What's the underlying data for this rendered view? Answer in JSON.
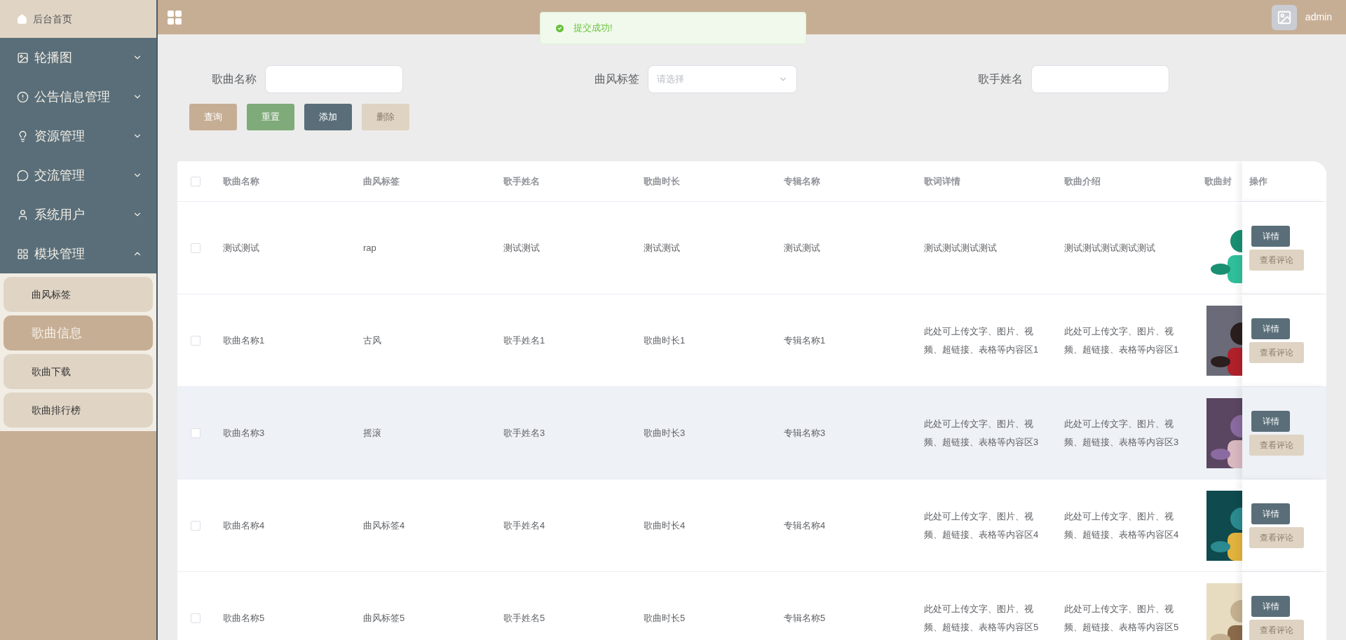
{
  "sidebar": {
    "home": "后台首页",
    "items": [
      {
        "label": "轮播图",
        "expanded": false
      },
      {
        "label": "公告信息管理",
        "expanded": false
      },
      {
        "label": "资源管理",
        "expanded": false
      },
      {
        "label": "交流管理",
        "expanded": false
      },
      {
        "label": "系统用户",
        "expanded": false
      },
      {
        "label": "模块管理",
        "expanded": true,
        "children": [
          {
            "label": "曲风标签",
            "selected": false
          },
          {
            "label": "歌曲信息",
            "selected": true
          },
          {
            "label": "歌曲下载",
            "selected": false
          },
          {
            "label": "歌曲排行榜",
            "selected": false
          }
        ]
      }
    ]
  },
  "top_bar": {
    "user": "admin"
  },
  "toast": {
    "message": "提交成功!"
  },
  "filters": [
    {
      "kind": "input",
      "label": "歌曲名称"
    },
    {
      "kind": "select",
      "label": "曲风标签",
      "placeholder": "请选择"
    },
    {
      "kind": "input",
      "label": "歌手姓名"
    }
  ],
  "buttons": [
    {
      "label": "查询",
      "color": "#c6ae95",
      "disabled": false
    },
    {
      "label": "重置",
      "color": "#7faa7a",
      "disabled": false
    },
    {
      "label": "添加",
      "color": "#596e79",
      "disabled": false
    },
    {
      "label": "删除",
      "color": "#dfd3c3",
      "disabled": true
    }
  ],
  "table": {
    "header_checked": false,
    "columns": [
      "歌曲名称",
      "曲风标签",
      "歌手姓名",
      "歌曲时长",
      "专辑名称",
      "歌词详情",
      "歌曲介绍",
      "歌曲封"
    ],
    "action_column": "操作",
    "rows": [
      {
        "checked": false,
        "highlighted": false,
        "cells": [
          "测试测试",
          "rap",
          "测试测试",
          "测试测试",
          "测试测试",
          "测试测试测试测试",
          "测试测试测试测试测试"
        ],
        "cover": {
          "kind": "picture"
        },
        "actions": [
          "详情",
          "查看评论"
        ]
      },
      {
        "checked": false,
        "highlighted": false,
        "cells": [
          "歌曲名称1",
          "古风",
          "歌手姓名1",
          "歌曲时长1",
          "专辑名称1",
          "此处可上传文字、图片、视频、超链接、表格等内容区1",
          "此处可上传文字、图片、视频、超链接、表格等内容区1"
        ],
        "cover": {
          "kind": "picture"
        },
        "actions": [
          "详情",
          "查看评论"
        ]
      },
      {
        "checked": false,
        "highlighted": true,
        "cells": [
          "歌曲名称3",
          "摇滚",
          "歌手姓名3",
          "歌曲时长3",
          "专辑名称3",
          "此处可上传文字、图片、视频、超链接、表格等内容区3",
          "此处可上传文字、图片、视频、超链接、表格等内容区3"
        ],
        "cover": {
          "kind": "picture"
        },
        "actions": [
          "详情",
          "查看评论"
        ]
      },
      {
        "checked": false,
        "highlighted": false,
        "cells": [
          "歌曲名称4",
          "曲风标签4",
          "歌手姓名4",
          "歌曲时长4",
          "专辑名称4",
          "此处可上传文字、图片、视频、超链接、表格等内容区4",
          "此处可上传文字、图片、视频、超链接、表格等内容区4"
        ],
        "cover": {
          "kind": "picture"
        },
        "actions": [
          "详情",
          "查看评论"
        ]
      },
      {
        "checked": false,
        "highlighted": false,
        "cells": [
          "歌曲名称5",
          "曲风标签5",
          "歌手姓名5",
          "歌曲时长5",
          "专辑名称5",
          "此处可上传文字、图片、视频、超链接、表格等内容区5",
          "此处可上传文字、图片、视频、超链接、表格等内容区5"
        ],
        "cover": {
          "kind": "picture"
        },
        "actions": [
          "详情",
          "查看评论"
        ]
      }
    ]
  }
}
